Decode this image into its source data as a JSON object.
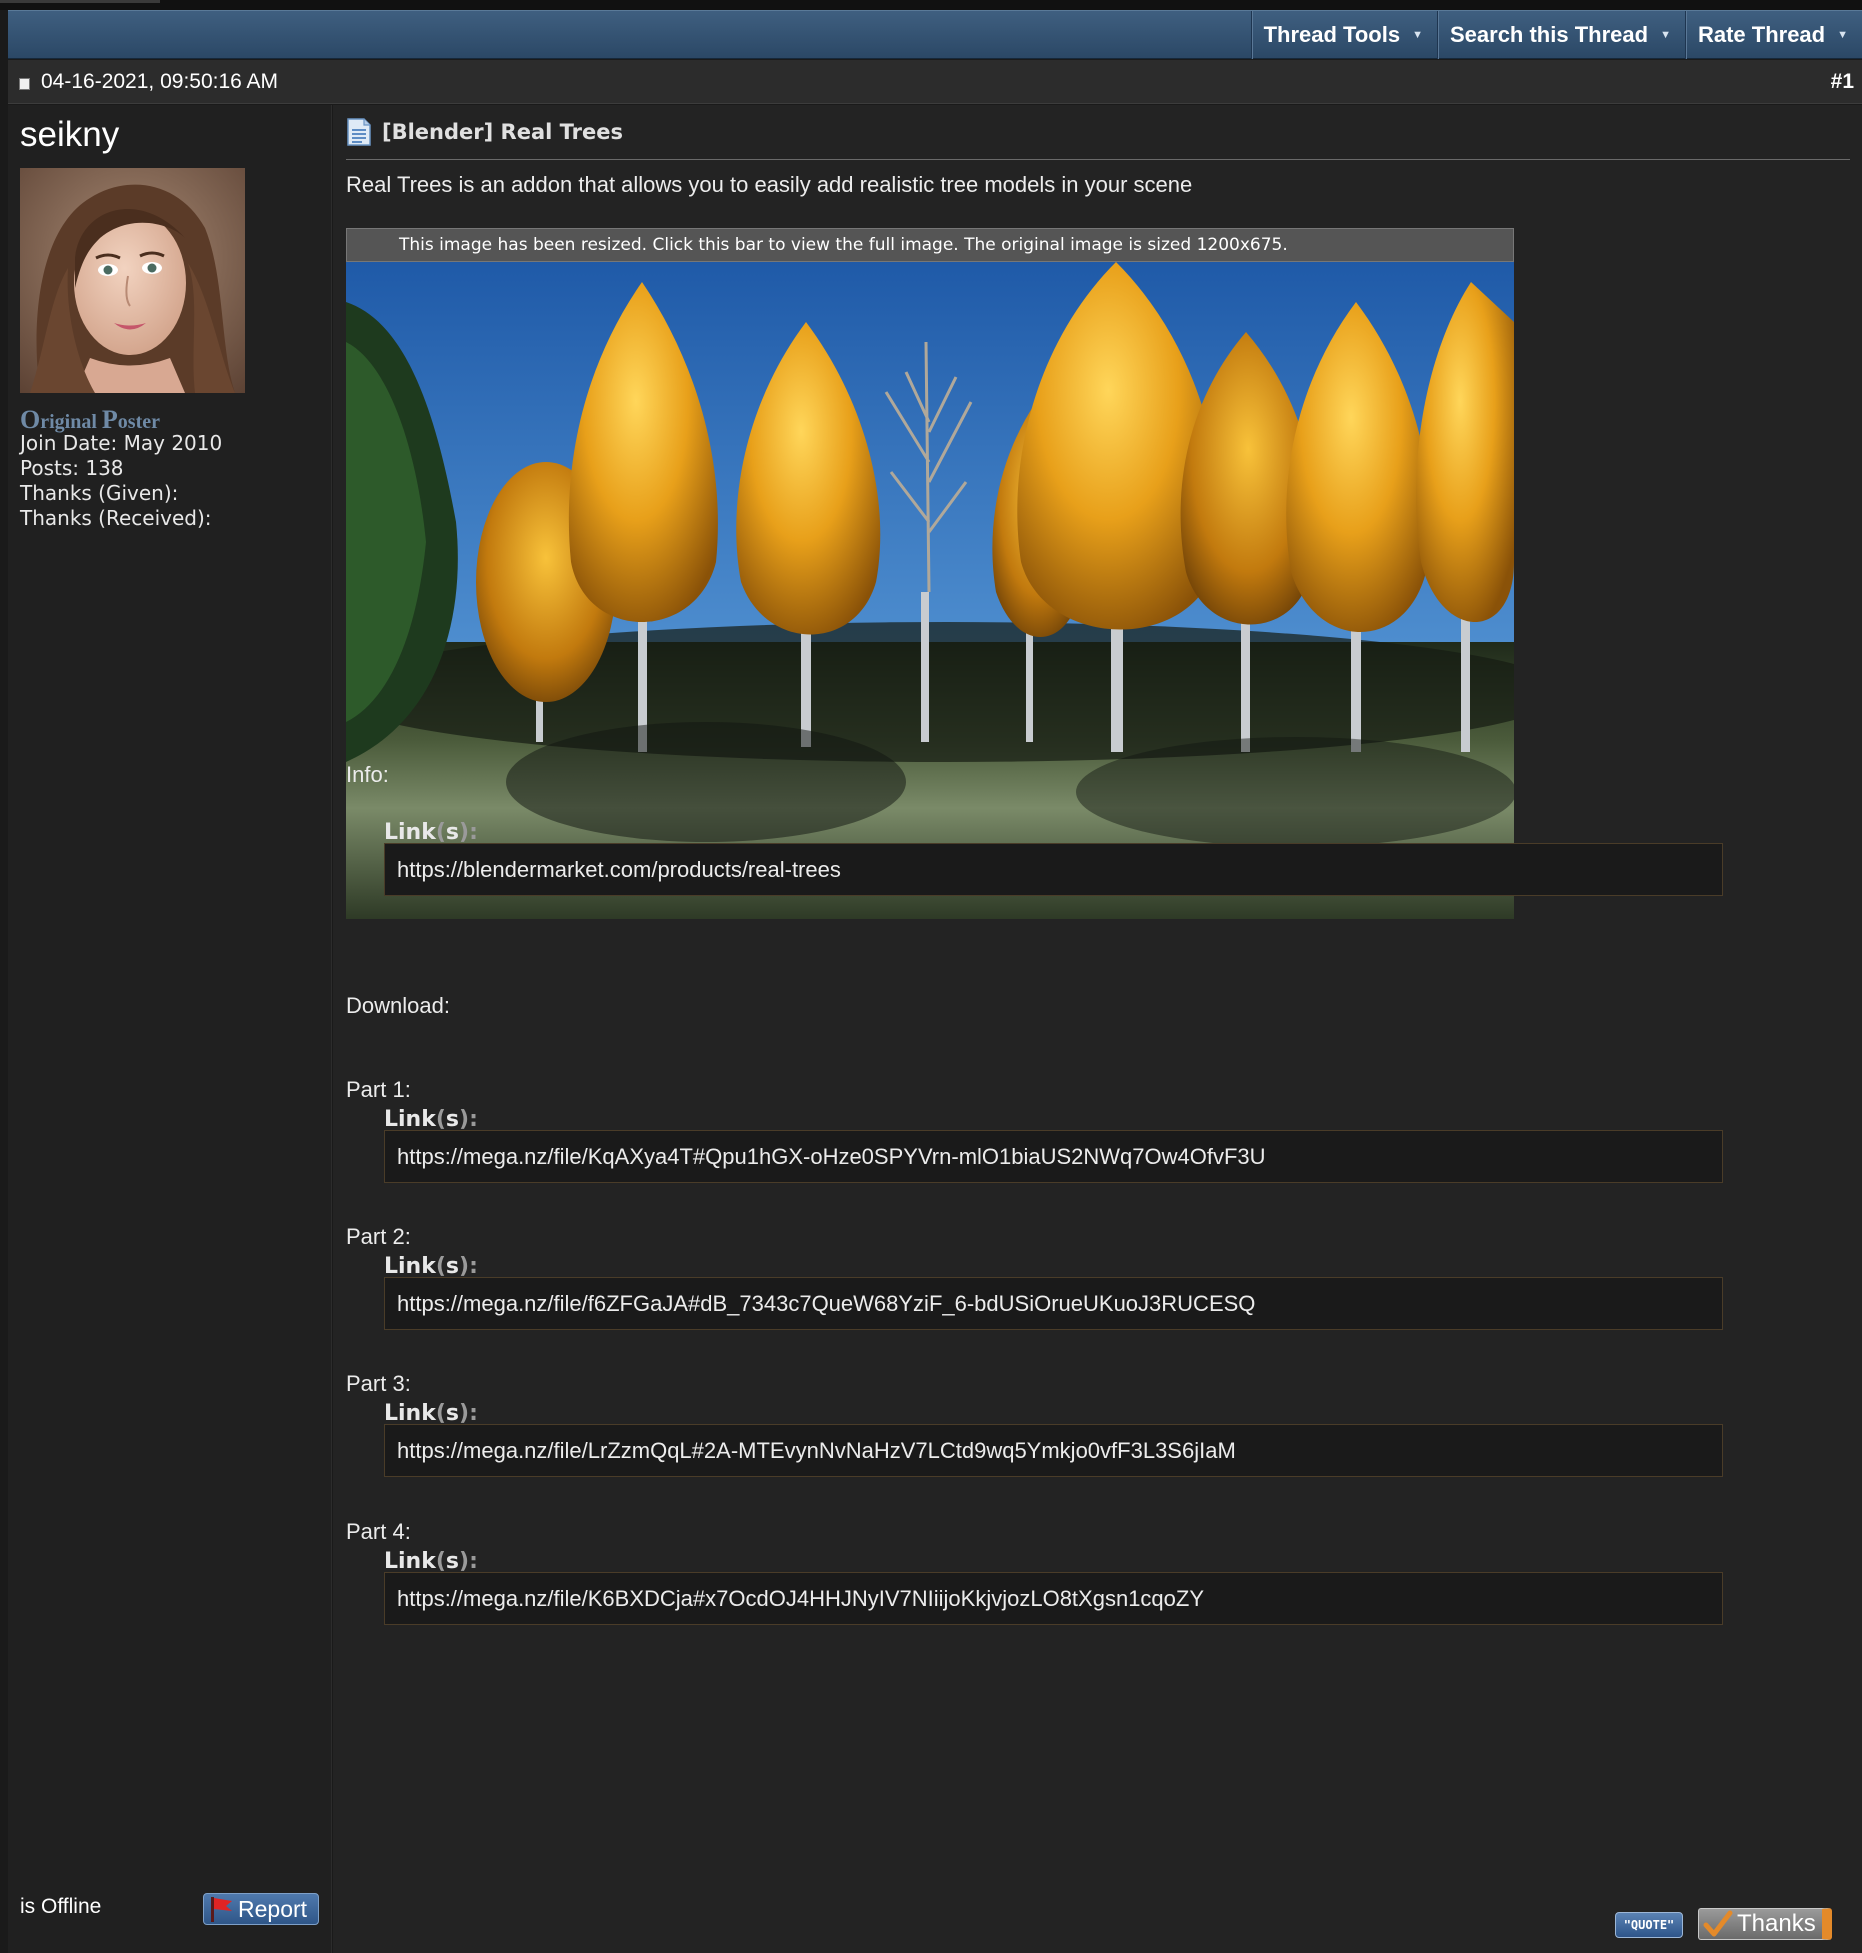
{
  "toolbar": {
    "thread_tools": "Thread Tools",
    "search_thread": "Search this Thread",
    "rate_thread": "Rate Thread",
    "arrow": "▼"
  },
  "post": {
    "date": "04-16-2021, 09:50:16 AM",
    "number": "#1",
    "title": "[Blender] Real Trees",
    "intro": "Real Trees is an addon that allows you to easily add realistic tree models in your scene",
    "resize_notice": "This image has been resized. Click this bar to view the full image. The original image is sized 1200x675.",
    "info_label": "Info:",
    "download_label": "Download:",
    "link_label": {
      "word": "Link",
      "open": "(",
      "s": "s",
      "close": "):"
    },
    "info_link": "https://blendermarket.com/products/real-trees",
    "parts": [
      {
        "label": "Part 1:",
        "url": "https://mega.nz/file/KqAXya4T#Qpu1hGX-oHze0SPYVrn-mlO1biaUS2NWq7Ow4OfvF3U"
      },
      {
        "label": "Part 2:",
        "url": "https://mega.nz/file/f6ZFGaJA#dB_7343c7QueW68YziF_6-bdUSiOrueUKuoJ3RUCESQ"
      },
      {
        "label": "Part 3:",
        "url": "https://mega.nz/file/LrZzmQqL#2A-MTEvynNvNaHzV7LCtd9wq5Ymkjo0vfF3L3S6jIaM"
      },
      {
        "label": "Part 4:",
        "url": "https://mega.nz/file/K6BXDCja#x7OcdOJ4HHJNyIV7NIiijoKkjvjozLO8tXgsn1cqoZY"
      }
    ]
  },
  "user": {
    "name": "seikny",
    "rank_first_O": "O",
    "rank_first_rest": "riginal ",
    "rank_second_P": "P",
    "rank_second_rest": "oster",
    "join_date": "Join Date: May 2010",
    "posts": "Posts: 138",
    "thanks_given": "Thanks (Given):",
    "thanks_received": "Thanks (Received):",
    "status": "is Offline",
    "report": "Report"
  },
  "buttons": {
    "quote": "\"QUOTE\"",
    "thanks": "Thanks"
  },
  "colors": {
    "toolbar": "#34526f",
    "rank": "#6f8aa6",
    "thanks_accent": "#e48a2a"
  }
}
